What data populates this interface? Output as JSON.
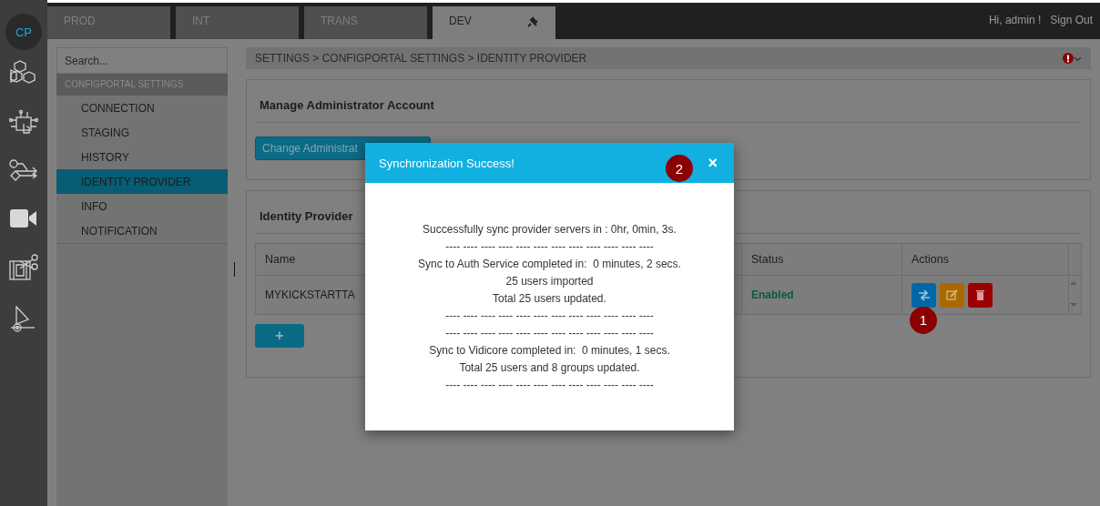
{
  "logo": "CP",
  "env_tabs": [
    {
      "label": "PROD",
      "selected": false
    },
    {
      "label": "INT",
      "selected": false
    },
    {
      "label": "TRANS",
      "selected": false
    },
    {
      "label": "DEV",
      "selected": true
    }
  ],
  "user": {
    "greeting": "Hi, admin !",
    "sign_out": "Sign Out"
  },
  "settings_nav": {
    "search": {
      "placeholder": "Search..."
    },
    "section": "CONFIGPORTAL SETTINGS",
    "items": [
      {
        "label": "CONNECTION",
        "selected": false
      },
      {
        "label": "STAGING",
        "selected": false
      },
      {
        "label": "HISTORY",
        "selected": false
      },
      {
        "label": "IDENTITY PROVIDER",
        "selected": true
      },
      {
        "label": "INFO",
        "selected": false
      },
      {
        "label": "NOTIFICATION",
        "selected": false
      }
    ]
  },
  "breadcrumb": "SETTINGS > CONFIGPORTAL SETTINGS > IDENTITY PROVIDER",
  "admin_panel": {
    "title": "Manage Administrator Account",
    "button": "Change Administrat"
  },
  "idp_panel": {
    "title": "Identity Provider",
    "table": {
      "columns": [
        "Name",
        "Status",
        "Actions"
      ],
      "rows": [
        {
          "name": "MYKICKSTARTTA",
          "status": "Enabled",
          "actions": [
            {
              "kind": "sync",
              "annotation": "1"
            },
            {
              "kind": "edit"
            },
            {
              "kind": "delete"
            }
          ]
        }
      ]
    },
    "add_button": "+"
  },
  "modal": {
    "title": "Synchronization Success!",
    "annotation": "2",
    "close": "×",
    "lines": [
      "Successfully sync provider servers in : 0hr, 0min, 3s.",
      "---- ---- ---- ---- ---- ---- ---- ---- ---- ---- ---- ----",
      "Sync to Auth Service completed in:  0 minutes, 2 secs.",
      "25 users imported",
      "Total 25 users updated.",
      "---- ---- ---- ---- ---- ---- ---- ---- ---- ---- ---- ----",
      "---- ---- ---- ---- ---- ---- ---- ---- ---- ---- ---- ----",
      "Sync to Vidicore completed in:  0 minutes, 1 secs.",
      "Total 25 users and 8 groups updated.",
      "---- ---- ---- ---- ---- ---- ---- ---- ---- ---- ---- ----"
    ]
  }
}
